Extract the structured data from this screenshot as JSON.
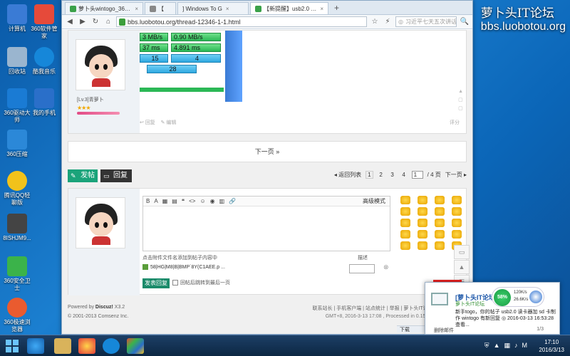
{
  "desktop": {
    "icons": [
      {
        "label": "计算机",
        "color": "#3a7bd5"
      },
      {
        "label": "360软件管家",
        "color": "#e64a3a"
      },
      {
        "label": "回收站",
        "color": "#9ab5cf"
      },
      {
        "label": "酷我音乐",
        "color": "#1687d9"
      },
      {
        "label": "360驱动大师",
        "color": "#1a7bd4"
      },
      {
        "label": "我的手机",
        "color": "#2a6fc9"
      },
      {
        "label": "360压缩",
        "color": "#2b88d8"
      },
      {
        "label": "腾讯QQ轻聊版",
        "color": "#f1c21b"
      },
      {
        "label": "8ISHJM9...",
        "color": "#444"
      },
      {
        "label": "360安全卫士",
        "color": "#3bb34a"
      },
      {
        "label": "360极速浏览器",
        "color": "#ea5b2f"
      }
    ]
  },
  "watermark": {
    "line1": "萝卜头IT论坛",
    "line2": "bbs.luobotou.org"
  },
  "browser": {
    "tabs": [
      {
        "label": "萝卜头wintogo_360搜索",
        "active": false
      },
      {
        "label": "【",
        "active": false
      },
      {
        "label": "] Windows To G",
        "active": false
      },
      {
        "label": "【新提醒】usb2.0 读卡器处",
        "active": true
      }
    ],
    "new_tab": "+",
    "address": "bbs.luobotou.org/thread-12346-1-1.html",
    "search_placeholder": "习近平七天五次讲话"
  },
  "post1": {
    "bench": [
      [
        "3 MB/s",
        "0.90 MB/s"
      ],
      [
        "37 ms",
        "4.891 ms"
      ],
      [
        "15",
        "4"
      ],
      [
        "28"
      ]
    ],
    "rank": "[Lv.3]青萝卜",
    "stars": "★★★",
    "reply_label": "回复",
    "edit_label": "编辑",
    "report_label": "评分"
  },
  "nav": {
    "next_page": "下一页 »"
  },
  "actions": {
    "new_post": "发帖",
    "reply": "回复",
    "back_list": "◂ 返回列表",
    "pages": [
      "1",
      "2",
      "3",
      "4"
    ],
    "page_input": "1",
    "total_pages": "/ 4 页",
    "next": "下一页 ▸"
  },
  "reply_box": {
    "toolbar": [
      "B",
      "A",
      "▦",
      "▤",
      "❝",
      "<>",
      "☺",
      "◉",
      "▥",
      "🔗"
    ],
    "advanced": "高级模式",
    "hint": "点击附件文件名添加到帖子内容中",
    "desc_label": "描述",
    "attachment": "58|HG|M8|B|BMP`8Y(C1AEE.p ...",
    "submit": "发表回复",
    "checkbox": "回帖后跳转到最后一页"
  },
  "footer": {
    "powered_prefix": "Powered by ",
    "powered_brand": "Discuz!",
    "powered_ver": " X3.2",
    "copyright": "© 2001-2013 Comsenz Inc.",
    "links": "联系站长 | 手机客户端 | 站点统计 | 举报 | 萝卜头IT论坛 ( 苏ICP备1505",
    "gmt": "GMT+8, 2016-3-13 17:08 , Processed in 0.150901 second(s), Q",
    "dl_prev": "",
    "dl_label": "下载"
  },
  "notification": {
    "title": "[萝卜头IT论坛] 你的帖",
    "site": "萝卜头IT论坛",
    "body": "新手togo，你的帖子 usb2.0 读卡器加 sd 卡制作 wintogo 有新回复 ◎ 2016-03-13 16:53:28 查看...",
    "delete": "删除邮件",
    "page": "1/3",
    "speed_pct": "58%",
    "speed_up": "120K/s",
    "speed_down": "26.6K/s"
  },
  "taskbar": {
    "time": "17:10",
    "date": "2016/3/13",
    "tray_ime": "M"
  }
}
